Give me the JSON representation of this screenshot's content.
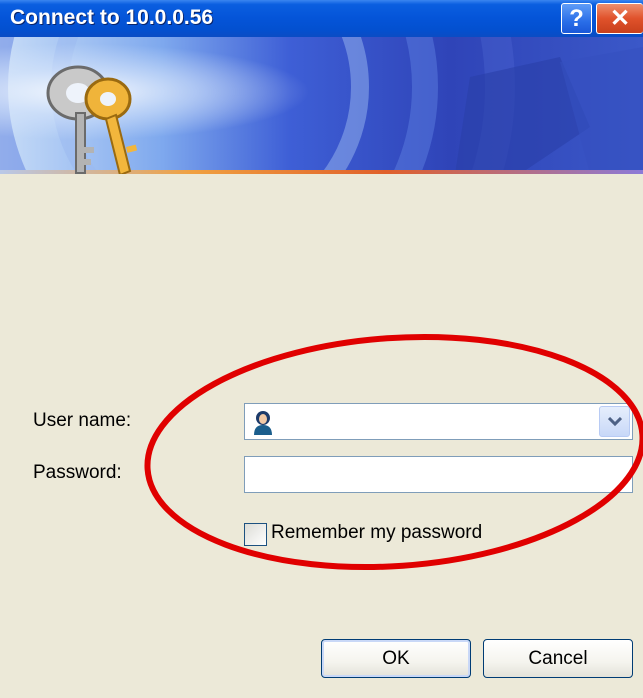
{
  "window": {
    "title": "Connect to 10.0.0.56",
    "help_label": "?",
    "close_label": "✕"
  },
  "form": {
    "username_label": "User name:",
    "username_value": "",
    "password_label": "Password:",
    "password_value": "",
    "remember_label": "Remember my password",
    "remember_checked": false
  },
  "buttons": {
    "ok_label": "OK",
    "cancel_label": "Cancel"
  },
  "icons": {
    "banner": "keys-icon",
    "username": "user-icon",
    "dropdown": "chevron-down-icon"
  },
  "colors": {
    "titlebar": "#0454d8",
    "dialog_background": "#ece9d8",
    "annotation": "#e00000"
  }
}
